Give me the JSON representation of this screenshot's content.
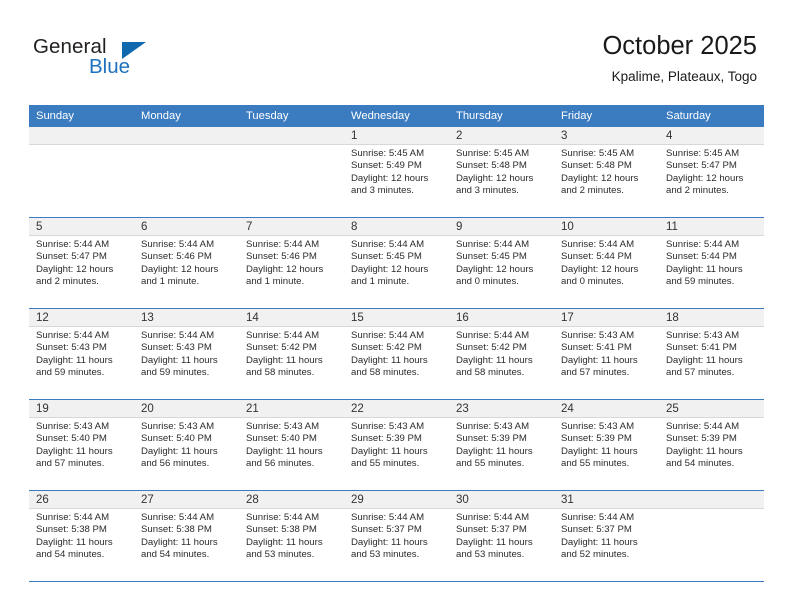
{
  "brand": {
    "name_top": "General",
    "name_bottom": "Blue",
    "accent_color": "#1068ad"
  },
  "header": {
    "title": "October 2025",
    "subtitle": "Kpalime, Plateaux, Togo"
  },
  "theme": {
    "header_row_bg": "#3b7cc0",
    "datebar_bg": "#f1f1f1",
    "text": "#2b2b2b"
  },
  "weekday_headers": [
    "Sunday",
    "Monday",
    "Tuesday",
    "Wednesday",
    "Thursday",
    "Friday",
    "Saturday"
  ],
  "weeks": [
    [
      {
        "day": "",
        "empty": true
      },
      {
        "day": "",
        "empty": true
      },
      {
        "day": "",
        "empty": true
      },
      {
        "day": "1",
        "sunrise": "Sunrise: 5:45 AM",
        "sunset": "Sunset: 5:49 PM",
        "daylight_1": "Daylight: 12 hours",
        "daylight_2": "and 3 minutes."
      },
      {
        "day": "2",
        "sunrise": "Sunrise: 5:45 AM",
        "sunset": "Sunset: 5:48 PM",
        "daylight_1": "Daylight: 12 hours",
        "daylight_2": "and 3 minutes."
      },
      {
        "day": "3",
        "sunrise": "Sunrise: 5:45 AM",
        "sunset": "Sunset: 5:48 PM",
        "daylight_1": "Daylight: 12 hours",
        "daylight_2": "and 2 minutes."
      },
      {
        "day": "4",
        "sunrise": "Sunrise: 5:45 AM",
        "sunset": "Sunset: 5:47 PM",
        "daylight_1": "Daylight: 12 hours",
        "daylight_2": "and 2 minutes."
      }
    ],
    [
      {
        "day": "5",
        "sunrise": "Sunrise: 5:44 AM",
        "sunset": "Sunset: 5:47 PM",
        "daylight_1": "Daylight: 12 hours",
        "daylight_2": "and 2 minutes."
      },
      {
        "day": "6",
        "sunrise": "Sunrise: 5:44 AM",
        "sunset": "Sunset: 5:46 PM",
        "daylight_1": "Daylight: 12 hours",
        "daylight_2": "and 1 minute."
      },
      {
        "day": "7",
        "sunrise": "Sunrise: 5:44 AM",
        "sunset": "Sunset: 5:46 PM",
        "daylight_1": "Daylight: 12 hours",
        "daylight_2": "and 1 minute."
      },
      {
        "day": "8",
        "sunrise": "Sunrise: 5:44 AM",
        "sunset": "Sunset: 5:45 PM",
        "daylight_1": "Daylight: 12 hours",
        "daylight_2": "and 1 minute."
      },
      {
        "day": "9",
        "sunrise": "Sunrise: 5:44 AM",
        "sunset": "Sunset: 5:45 PM",
        "daylight_1": "Daylight: 12 hours",
        "daylight_2": "and 0 minutes."
      },
      {
        "day": "10",
        "sunrise": "Sunrise: 5:44 AM",
        "sunset": "Sunset: 5:44 PM",
        "daylight_1": "Daylight: 12 hours",
        "daylight_2": "and 0 minutes."
      },
      {
        "day": "11",
        "sunrise": "Sunrise: 5:44 AM",
        "sunset": "Sunset: 5:44 PM",
        "daylight_1": "Daylight: 11 hours",
        "daylight_2": "and 59 minutes."
      }
    ],
    [
      {
        "day": "12",
        "sunrise": "Sunrise: 5:44 AM",
        "sunset": "Sunset: 5:43 PM",
        "daylight_1": "Daylight: 11 hours",
        "daylight_2": "and 59 minutes."
      },
      {
        "day": "13",
        "sunrise": "Sunrise: 5:44 AM",
        "sunset": "Sunset: 5:43 PM",
        "daylight_1": "Daylight: 11 hours",
        "daylight_2": "and 59 minutes."
      },
      {
        "day": "14",
        "sunrise": "Sunrise: 5:44 AM",
        "sunset": "Sunset: 5:42 PM",
        "daylight_1": "Daylight: 11 hours",
        "daylight_2": "and 58 minutes."
      },
      {
        "day": "15",
        "sunrise": "Sunrise: 5:44 AM",
        "sunset": "Sunset: 5:42 PM",
        "daylight_1": "Daylight: 11 hours",
        "daylight_2": "and 58 minutes."
      },
      {
        "day": "16",
        "sunrise": "Sunrise: 5:44 AM",
        "sunset": "Sunset: 5:42 PM",
        "daylight_1": "Daylight: 11 hours",
        "daylight_2": "and 58 minutes."
      },
      {
        "day": "17",
        "sunrise": "Sunrise: 5:43 AM",
        "sunset": "Sunset: 5:41 PM",
        "daylight_1": "Daylight: 11 hours",
        "daylight_2": "and 57 minutes."
      },
      {
        "day": "18",
        "sunrise": "Sunrise: 5:43 AM",
        "sunset": "Sunset: 5:41 PM",
        "daylight_1": "Daylight: 11 hours",
        "daylight_2": "and 57 minutes."
      }
    ],
    [
      {
        "day": "19",
        "sunrise": "Sunrise: 5:43 AM",
        "sunset": "Sunset: 5:40 PM",
        "daylight_1": "Daylight: 11 hours",
        "daylight_2": "and 57 minutes."
      },
      {
        "day": "20",
        "sunrise": "Sunrise: 5:43 AM",
        "sunset": "Sunset: 5:40 PM",
        "daylight_1": "Daylight: 11 hours",
        "daylight_2": "and 56 minutes."
      },
      {
        "day": "21",
        "sunrise": "Sunrise: 5:43 AM",
        "sunset": "Sunset: 5:40 PM",
        "daylight_1": "Daylight: 11 hours",
        "daylight_2": "and 56 minutes."
      },
      {
        "day": "22",
        "sunrise": "Sunrise: 5:43 AM",
        "sunset": "Sunset: 5:39 PM",
        "daylight_1": "Daylight: 11 hours",
        "daylight_2": "and 55 minutes."
      },
      {
        "day": "23",
        "sunrise": "Sunrise: 5:43 AM",
        "sunset": "Sunset: 5:39 PM",
        "daylight_1": "Daylight: 11 hours",
        "daylight_2": "and 55 minutes."
      },
      {
        "day": "24",
        "sunrise": "Sunrise: 5:43 AM",
        "sunset": "Sunset: 5:39 PM",
        "daylight_1": "Daylight: 11 hours",
        "daylight_2": "and 55 minutes."
      },
      {
        "day": "25",
        "sunrise": "Sunrise: 5:44 AM",
        "sunset": "Sunset: 5:39 PM",
        "daylight_1": "Daylight: 11 hours",
        "daylight_2": "and 54 minutes."
      }
    ],
    [
      {
        "day": "26",
        "sunrise": "Sunrise: 5:44 AM",
        "sunset": "Sunset: 5:38 PM",
        "daylight_1": "Daylight: 11 hours",
        "daylight_2": "and 54 minutes."
      },
      {
        "day": "27",
        "sunrise": "Sunrise: 5:44 AM",
        "sunset": "Sunset: 5:38 PM",
        "daylight_1": "Daylight: 11 hours",
        "daylight_2": "and 54 minutes."
      },
      {
        "day": "28",
        "sunrise": "Sunrise: 5:44 AM",
        "sunset": "Sunset: 5:38 PM",
        "daylight_1": "Daylight: 11 hours",
        "daylight_2": "and 53 minutes."
      },
      {
        "day": "29",
        "sunrise": "Sunrise: 5:44 AM",
        "sunset": "Sunset: 5:37 PM",
        "daylight_1": "Daylight: 11 hours",
        "daylight_2": "and 53 minutes."
      },
      {
        "day": "30",
        "sunrise": "Sunrise: 5:44 AM",
        "sunset": "Sunset: 5:37 PM",
        "daylight_1": "Daylight: 11 hours",
        "daylight_2": "and 53 minutes."
      },
      {
        "day": "31",
        "sunrise": "Sunrise: 5:44 AM",
        "sunset": "Sunset: 5:37 PM",
        "daylight_1": "Daylight: 11 hours",
        "daylight_2": "and 52 minutes."
      },
      {
        "day": "",
        "empty": true
      }
    ]
  ]
}
